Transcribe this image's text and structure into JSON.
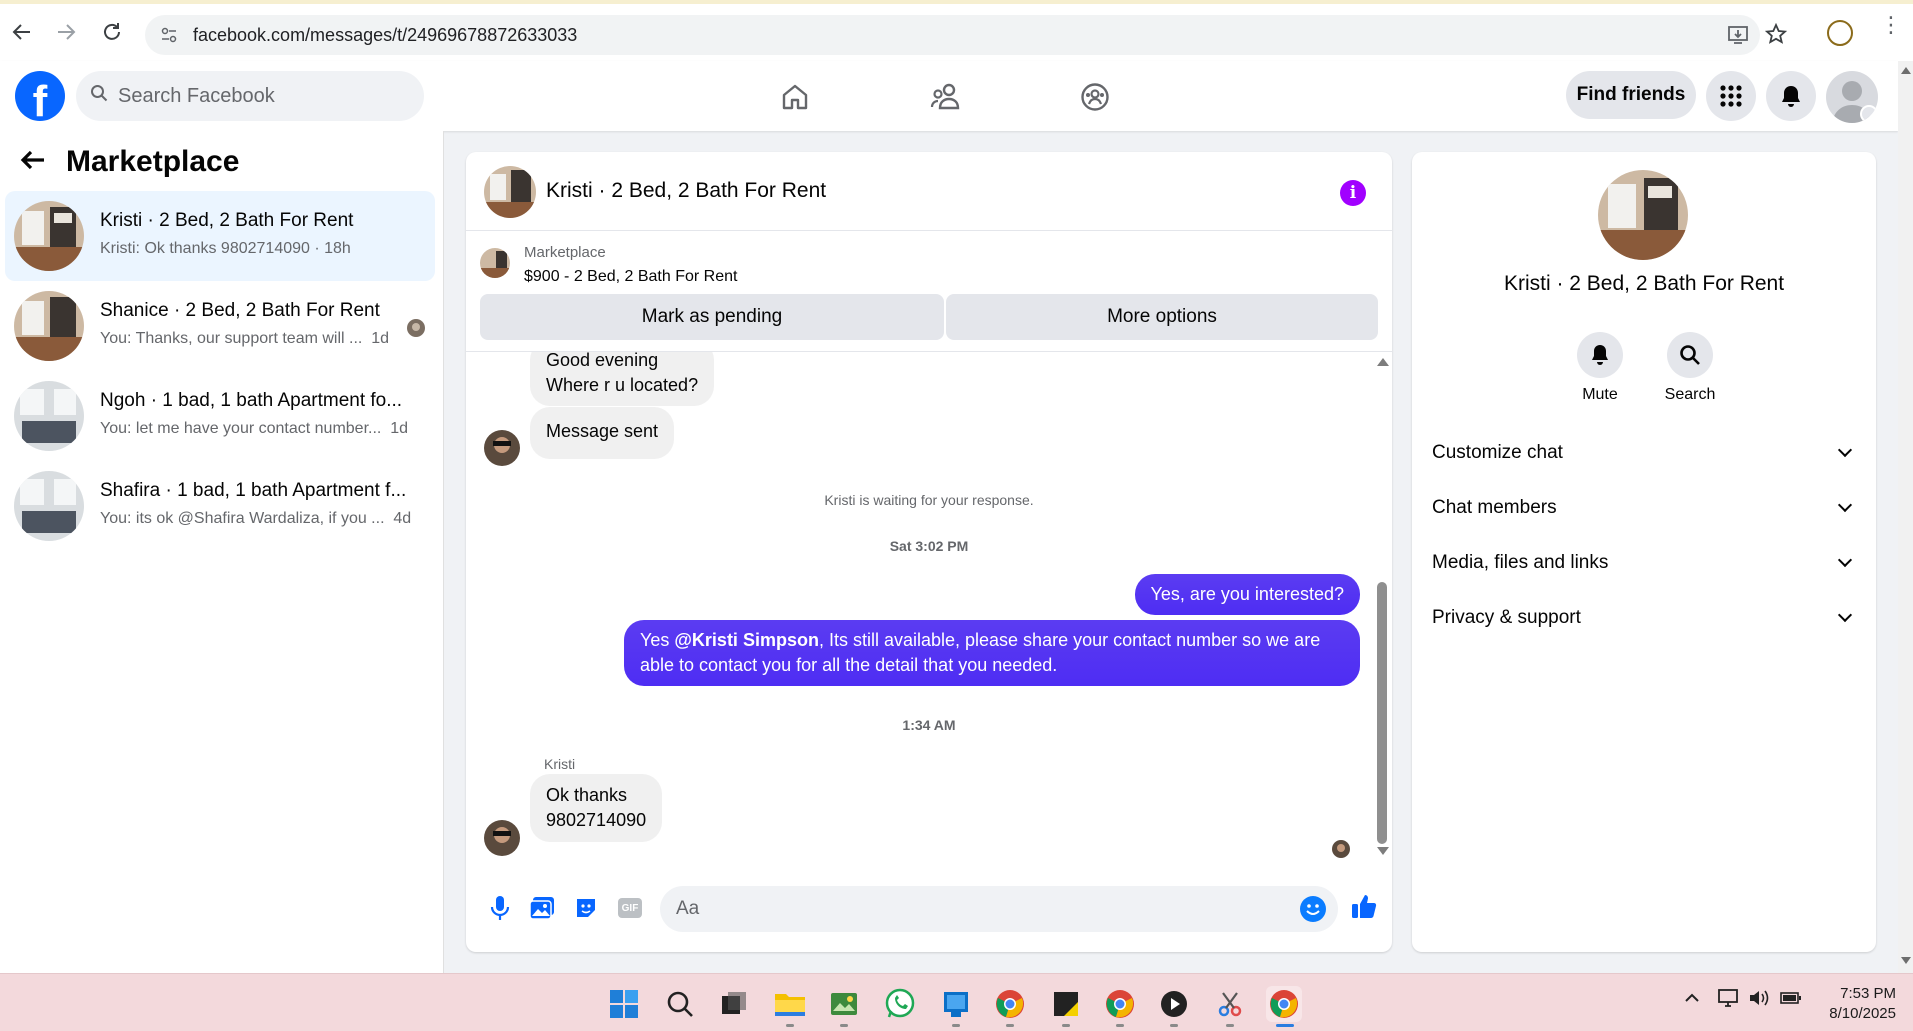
{
  "browser": {
    "url": "facebook.com/messages/t/24969678872633033"
  },
  "header": {
    "search_placeholder": "Search Facebook",
    "find_friends": "Find friends"
  },
  "sidebar": {
    "title": "Marketplace",
    "conversations": [
      {
        "name": "Kristi · 2 Bed, 2 Bath For Rent",
        "preview": "Kristi: Ok thanks 9802714090 · 18h",
        "active": true
      },
      {
        "name": "Shanice · 2 Bed, 2 Bath For Rent",
        "preview": "You: Thanks, our support team will ...",
        "time": "1d"
      },
      {
        "name": "Ngoh · 1 bad, 1 bath Apartment fo...",
        "preview": "You: let me have your contact number...",
        "time": "1d"
      },
      {
        "name": "Shafira · 1 bad, 1 bath Apartment f...",
        "preview": "You: its ok @Shafira Wardaliza, if you ...",
        "time": "4d"
      }
    ]
  },
  "chat": {
    "title": "Kristi · 2 Bed, 2 Bath For Rent",
    "listing_label": "Marketplace",
    "listing_price": "$900 - 2 Bed, 2 Bath For Rent",
    "mark_pending": "Mark as pending",
    "more_options": "More options",
    "messages": {
      "in1_line1": "Good evening",
      "in1_line2": "Where r u located?",
      "in2": "Message sent",
      "waiting": "Kristi is waiting for your response.",
      "ts1": "Sat 3:02 PM",
      "out1": "Yes, are you interested?",
      "out2_mention": "@Kristi Simpson",
      "out2_prefix": "Yes ",
      "out2_rest": ",  Its still available, please share your contact number so we are able to contact you for all the detail that you needed.",
      "ts2": "1:34 AM",
      "sender": "Kristi",
      "in3_line1": "Ok thanks",
      "in3_line2": "9802714090"
    },
    "composer_placeholder": "Aa"
  },
  "details": {
    "name": "Kristi · 2 Bed, 2 Bath For Rent",
    "mute": "Mute",
    "search": "Search",
    "sections": [
      "Customize chat",
      "Chat members",
      "Media, files and links",
      "Privacy & support"
    ]
  },
  "taskbar": {
    "time": "7:53 PM",
    "date": "8/10/2025"
  },
  "colors": {
    "fb_blue": "#0866ff",
    "outgoing_bubble": "#4e2df3",
    "info_purple": "#a100ff",
    "active_conv": "#ebf5ff"
  }
}
